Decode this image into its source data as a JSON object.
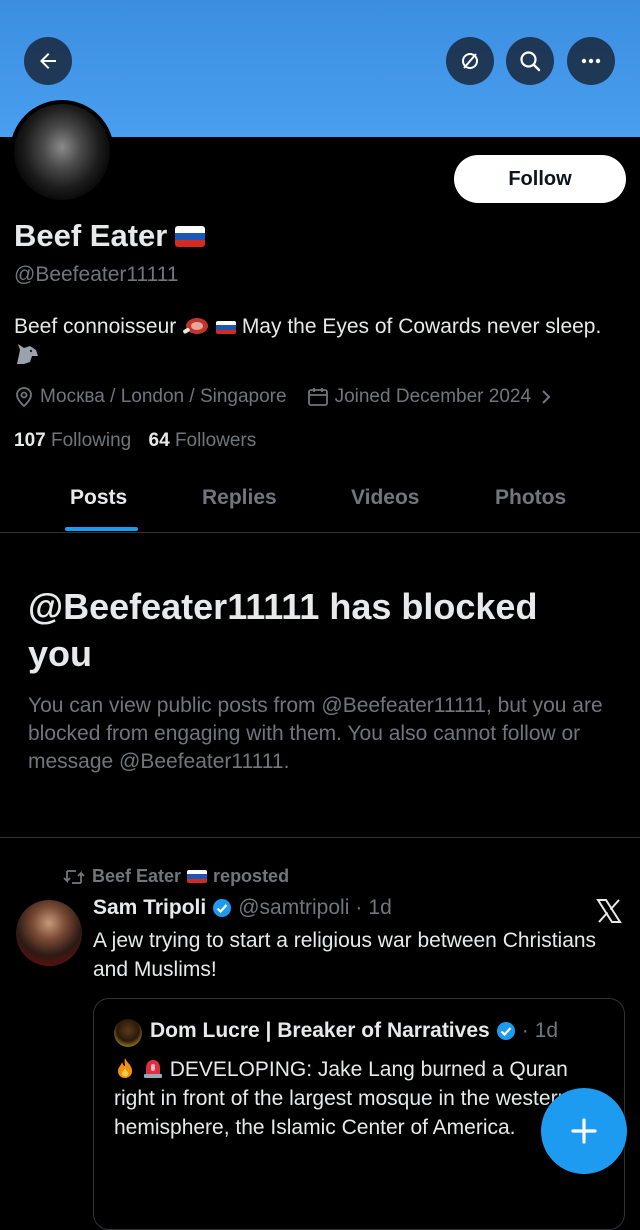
{
  "header": {
    "back_icon": "arrow-left-icon",
    "actions": [
      "location-off-icon",
      "search-icon",
      "more-icon"
    ]
  },
  "profile": {
    "name": "Beef Eater",
    "handle": "@Beefeater11111",
    "follow_label": "Follow",
    "bio_part1": "Beef connoisseur",
    "bio_part2": "May the Eyes of Cowards never sleep.",
    "location": "Москва / London / Singapore",
    "joined": "Joined December 2024",
    "following_count": "107",
    "following_label": "Following",
    "followers_count": "64",
    "followers_label": "Followers"
  },
  "tabs": [
    {
      "label": "Posts",
      "active": true
    },
    {
      "label": "Replies",
      "active": false
    },
    {
      "label": "Videos",
      "active": false
    },
    {
      "label": "Photos",
      "active": false
    }
  ],
  "blocked": {
    "title": "@Beefeater11111 has blocked you",
    "description": "You can view public posts from @Beefeater11111, but you are blocked from engaging with them. You also cannot follow or message @Beefeater11111."
  },
  "post": {
    "repost_name": "Beef Eater",
    "repost_label": "reposted",
    "author_name": "Sam Tripoli",
    "author_handle": "@samtripoli",
    "separator": "·",
    "time": "1d",
    "text": "A jew trying to start a religious war between Christians and Muslims!",
    "quote": {
      "author_name": "Dom Lucre | Breaker of Narratives",
      "separator": "·",
      "time": "1d",
      "text": "DEVELOPING: Jake Lang burned a Quran right in front of the largest mosque in the western hemisphere, the Islamic Center of America."
    }
  },
  "colors": {
    "accent": "#1d9bf0",
    "banner": "#4a9eef",
    "background": "#000000",
    "text_primary": "#e7e9ea",
    "text_secondary": "#71767b"
  }
}
